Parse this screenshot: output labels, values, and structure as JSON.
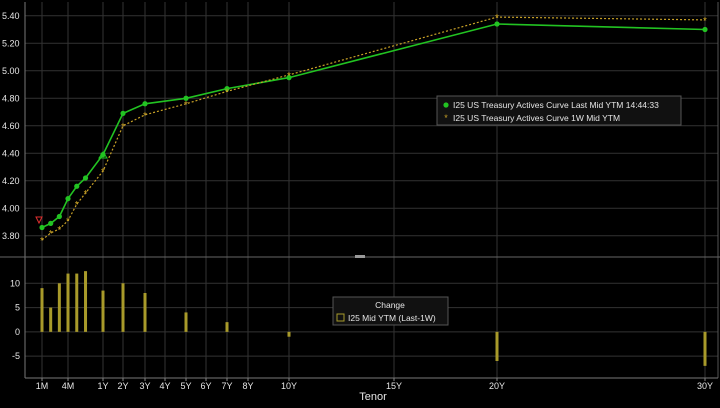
{
  "chart_data": [
    {
      "type": "line",
      "panel": "yield-curve",
      "xlabel": "Tenor",
      "x_tick_labels": [
        "1M",
        "4M",
        "1Y",
        "2Y",
        "3Y",
        "4Y",
        "5Y",
        "6Y",
        "7Y",
        "8Y",
        "10Y",
        "15Y",
        "20Y",
        "30Y"
      ],
      "x_tick_years": [
        0.0833,
        0.333,
        1,
        2,
        3,
        4,
        5,
        6,
        7,
        8,
        10,
        15,
        20,
        30
      ],
      "y_tick_labels": [
        "3.80",
        "4.00",
        "4.20",
        "4.40",
        "4.60",
        "4.80",
        "5.00",
        "5.20",
        "5.40"
      ],
      "ylim": [
        3.66,
        5.5
      ],
      "grid": true,
      "legend_position": "right",
      "series": [
        {
          "name": "I25 US Treasury Actives Curve Last Mid YTM 14:44:33",
          "color": "#22c322",
          "marker": "dot",
          "x_years": [
            0.0833,
            0.1667,
            0.25,
            0.333,
            0.5,
            0.667,
            1,
            2,
            3,
            5,
            7,
            10,
            20,
            30
          ],
          "values": [
            3.86,
            3.89,
            3.94,
            4.07,
            4.16,
            4.22,
            4.39,
            4.69,
            4.76,
            4.8,
            4.87,
            4.95,
            5.34,
            5.3
          ]
        },
        {
          "name": "I25 US Treasury Actives Curve 1W Mid YTM",
          "color": "#c9a227",
          "marker": "star",
          "x_years": [
            0.0833,
            0.1667,
            0.25,
            0.333,
            0.5,
            0.667,
            1,
            2,
            3,
            5,
            7,
            10,
            20,
            30
          ],
          "values": [
            3.77,
            3.82,
            3.85,
            3.91,
            4.03,
            4.11,
            4.27,
            4.6,
            4.68,
            4.76,
            4.85,
            4.97,
            5.39,
            5.37
          ]
        }
      ]
    },
    {
      "type": "bar",
      "panel": "change",
      "title": "Change",
      "y_tick_labels": [
        "10",
        "5",
        "0",
        "-5"
      ],
      "ylim": [
        -9.5,
        15
      ],
      "grid": true,
      "legend_position": "center",
      "series": [
        {
          "name": "I25 Mid YTM (Last-1W)",
          "color": "#a89a2a",
          "x_years": [
            0.0833,
            0.1667,
            0.25,
            0.333,
            0.5,
            0.667,
            1,
            2,
            3,
            5,
            7,
            10,
            20,
            30
          ],
          "values": [
            9,
            5,
            10,
            12,
            12,
            12.5,
            8.5,
            10,
            8,
            4,
            2,
            -1,
            -6,
            -7
          ]
        }
      ]
    }
  ]
}
